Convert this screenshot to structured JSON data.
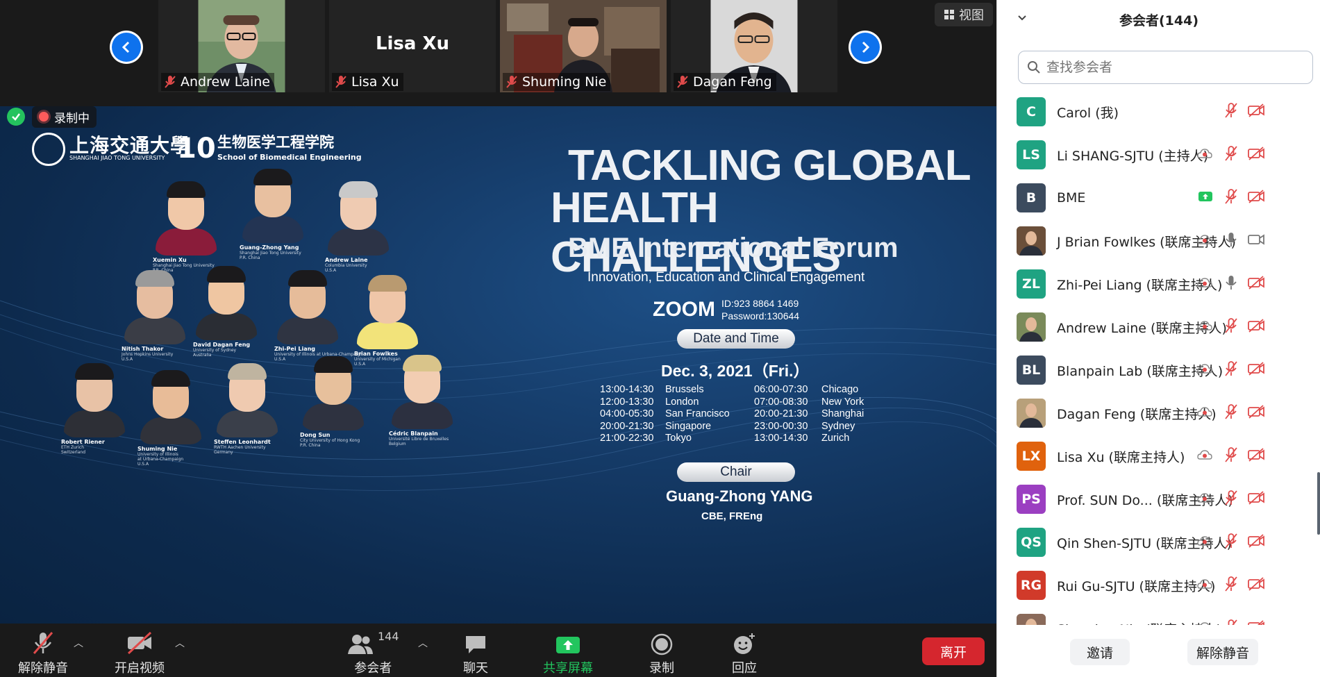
{
  "gallery": {
    "tiles": [
      {
        "name": "Andrew Laine",
        "video": true
      },
      {
        "name": "Lisa Xu",
        "video": false,
        "big_name": "Lisa Xu"
      },
      {
        "name": "Shuming Nie",
        "video": true
      },
      {
        "name": "Dagan Feng",
        "video": true
      }
    ],
    "view_label": "视图"
  },
  "recording": {
    "label": "录制中"
  },
  "slide": {
    "logos": {
      "sjtu_cn": "上海交通大學",
      "sjtu_en": "SHANGHAI JIAO TONG UNIVERSITY",
      "bme_mark": "10",
      "bme_cn": "生物医学工程学院",
      "bme_en": "School of Biomedical Engineering"
    },
    "title_line1": "TACKLING GLOBAL",
    "title_line2": "HEALTH CHALLENGES",
    "subtitle": "BME International Forum",
    "tagline": "Innovation, Education and Clinical Engagement",
    "zoom_logo": "ZOOM",
    "zoom_id": "ID:923 8864 1469",
    "zoom_password": "Password:130644",
    "date_pill": "Date and Time",
    "date": "Dec. 3, 2021（Fri.）",
    "schedule": [
      [
        "13:00-14:30",
        "Brussels",
        "06:00-07:30",
        "Chicago"
      ],
      [
        "12:00-13:30",
        "London",
        "07:00-08:30",
        "New York"
      ],
      [
        "04:00-05:30",
        "San Francisco",
        "20:00-21:30",
        "Shanghai"
      ],
      [
        "20:00-21:30",
        "Singapore",
        "23:00-00:30",
        "Sydney"
      ],
      [
        "21:00-22:30",
        "Tokyo",
        "13:00-14:30",
        "Zurich"
      ]
    ],
    "chair_pill": "Chair",
    "chair_name": "Guang-Zhong YANG",
    "chair_cred": "CBE, FREng",
    "speakers": [
      {
        "name": "Xuemin Xu",
        "aff1": "Shanghai Jiao Tong University",
        "aff2": "P.R. China",
        "aff3": ""
      },
      {
        "name": "Guang-Zhong Yang",
        "aff1": "Shanghai Jiao Tong University",
        "aff2": "P.R. China",
        "aff3": ""
      },
      {
        "name": "Andrew Laine",
        "aff1": "Columbia University",
        "aff2": "U.S.A",
        "aff3": ""
      },
      {
        "name": "Nitish Thakor",
        "aff1": "Johns Hopkins University",
        "aff2": "U.S.A",
        "aff3": ""
      },
      {
        "name": "David Dagan Feng",
        "aff1": "University of Sydney",
        "aff2": "Australia",
        "aff3": ""
      },
      {
        "name": "Zhi-Pei Liang",
        "aff1": "University of Illinois at Urbana-Champaign",
        "aff2": "U.S.A",
        "aff3": ""
      },
      {
        "name": "Brian Fowlkes",
        "aff1": "University of Michigan",
        "aff2": "U.S.A",
        "aff3": ""
      },
      {
        "name": "Robert Riener",
        "aff1": "ETH Zurich",
        "aff2": "Switzerland",
        "aff3": ""
      },
      {
        "name": "Shuming Nie",
        "aff1": "University of Illinois",
        "aff2": "at Urbana-Champaign",
        "aff3": "U.S.A"
      },
      {
        "name": "Steffen Leonhardt",
        "aff1": "RWTH Aachen University",
        "aff2": "Germany",
        "aff3": ""
      },
      {
        "name": "Dong Sun",
        "aff1": "City University of Hong Kong",
        "aff2": "P.R. China",
        "aff3": ""
      },
      {
        "name": "Cédric Blanpain",
        "aff1": "Université Libre de Bruxelles",
        "aff2": "Belgium",
        "aff3": ""
      }
    ]
  },
  "toolbar": {
    "unmute": "解除静音",
    "start_video": "开启视频",
    "participants": "参会者",
    "participant_count": "144",
    "chat": "聊天",
    "share": "共享屏幕",
    "record": "录制",
    "react": "回应",
    "leave": "离开"
  },
  "panel": {
    "title": "参会者(144)",
    "search_placeholder": "查找参会者",
    "participants": [
      {
        "initials": "C",
        "name": "Carol (我)",
        "color": "#1fa382",
        "photo": false,
        "rec": false,
        "share": false,
        "mic": "off",
        "cam": "off"
      },
      {
        "initials": "LS",
        "name": "Li SHANG-SJTU (主持人)",
        "color": "#1fa382",
        "photo": false,
        "rec": true,
        "share": false,
        "mic": "off",
        "cam": "off"
      },
      {
        "initials": "B",
        "name": "BME",
        "color": "#3c4b5e",
        "photo": false,
        "rec": false,
        "share": true,
        "mic": "off",
        "cam": "off"
      },
      {
        "initials": "",
        "name": "J Brian Fowlkes (联席主持人)",
        "color": "#6b4f3a",
        "photo": true,
        "rec": true,
        "share": false,
        "mic": "on",
        "cam": "on"
      },
      {
        "initials": "ZL",
        "name": "Zhi-Pei Liang (联席主持人)",
        "color": "#1fa382",
        "photo": false,
        "rec": true,
        "share": false,
        "mic": "on",
        "cam": "off"
      },
      {
        "initials": "",
        "name": "Andrew Laine (联席主持人)",
        "color": "#7a8a5a",
        "photo": true,
        "rec": true,
        "share": false,
        "mic": "off",
        "cam": "off"
      },
      {
        "initials": "BL",
        "name": "Blanpain Lab (联席主持人)",
        "color": "#3c4b5e",
        "photo": false,
        "rec": true,
        "share": false,
        "mic": "off",
        "cam": "off"
      },
      {
        "initials": "",
        "name": "Dagan Feng (联席主持人)",
        "color": "#b8a07a",
        "photo": true,
        "rec": true,
        "share": false,
        "mic": "off",
        "cam": "off"
      },
      {
        "initials": "LX",
        "name": "Lisa Xu (联席主持人)",
        "color": "#e0620d",
        "photo": false,
        "rec": true,
        "share": false,
        "mic": "off",
        "cam": "off"
      },
      {
        "initials": "PS",
        "name": "Prof. SUN Do...  (联席主持人)",
        "color": "#9b3fc1",
        "photo": false,
        "rec": true,
        "share": false,
        "mic": "off",
        "cam": "off"
      },
      {
        "initials": "QS",
        "name": "Qin Shen-SJTU (联席主持人)",
        "color": "#1fa382",
        "photo": false,
        "rec": true,
        "share": false,
        "mic": "off",
        "cam": "off"
      },
      {
        "initials": "RG",
        "name": "Rui Gu-SJTU (联席主持人)",
        "color": "#d13a2a",
        "photo": false,
        "rec": true,
        "share": false,
        "mic": "off",
        "cam": "off"
      },
      {
        "initials": "",
        "name": "Shuming Nie (联席主持人)",
        "color": "#8a6a5a",
        "photo": true,
        "rec": true,
        "share": false,
        "mic": "off",
        "cam": "off"
      }
    ],
    "invite": "邀请",
    "unmute_all": "解除静音"
  }
}
